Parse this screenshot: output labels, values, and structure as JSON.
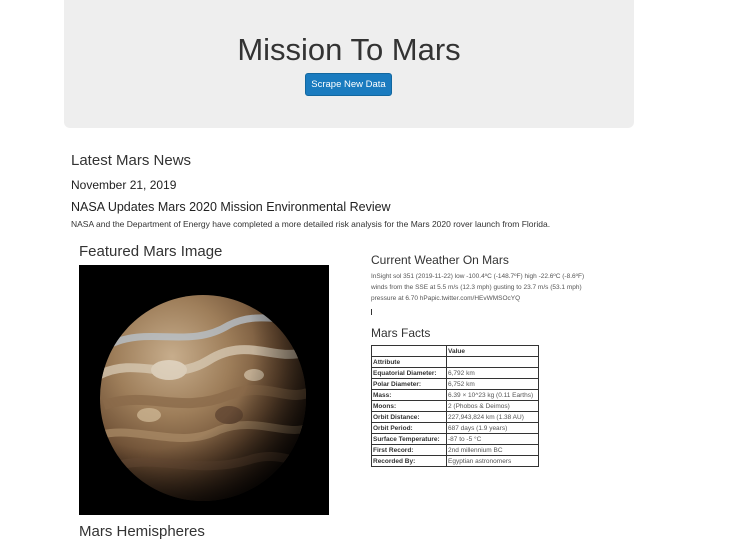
{
  "header": {
    "title": "Mission To Mars",
    "button_label": "Scrape New Data"
  },
  "news": {
    "heading": "Latest Mars News",
    "date": "November 21, 2019",
    "title": "NASA Updates Mars 2020 Mission Environmental Review",
    "paragraph": "NASA and the Department of Energy have completed a more detailed risk analysis for the Mars 2020 rover launch from Florida."
  },
  "featured": {
    "heading": "Featured Mars Image"
  },
  "weather": {
    "heading": "Current Weather On Mars",
    "text": "InSight sol 351 (2019-11-22) low -100.4ºC (-148.7ºF) high -22.6ºC (-8.6ºF) winds from the SSE at 5.5 m/s (12.3 mph) gusting to 23.7 m/s (53.1 mph) pressure at 6.70 hPapic.twitter.com/HEvWMSOcYQ"
  },
  "facts": {
    "heading": "Mars Facts",
    "header_col1": "",
    "header_col2": "Value",
    "rows": [
      {
        "k": "Attribute",
        "v": ""
      },
      {
        "k": "Equatorial Diameter:",
        "v": "6,792 km"
      },
      {
        "k": "Polar Diameter:",
        "v": "6,752 km"
      },
      {
        "k": "Mass:",
        "v": "6.39 × 10^23 kg (0.11 Earths)"
      },
      {
        "k": "Moons:",
        "v": "2 (Phobos & Deimos)"
      },
      {
        "k": "Orbit Distance:",
        "v": "227,943,824 km (1.38 AU)"
      },
      {
        "k": "Orbit Period:",
        "v": "687 days (1.9 years)"
      },
      {
        "k": "Surface Temperature:",
        "v": "-87 to -5 °C"
      },
      {
        "k": "First Record:",
        "v": "2nd millennium BC"
      },
      {
        "k": "Recorded By:",
        "v": "Egyptian astronomers"
      }
    ]
  },
  "hemispheres": {
    "heading": "Mars Hemispheres"
  }
}
